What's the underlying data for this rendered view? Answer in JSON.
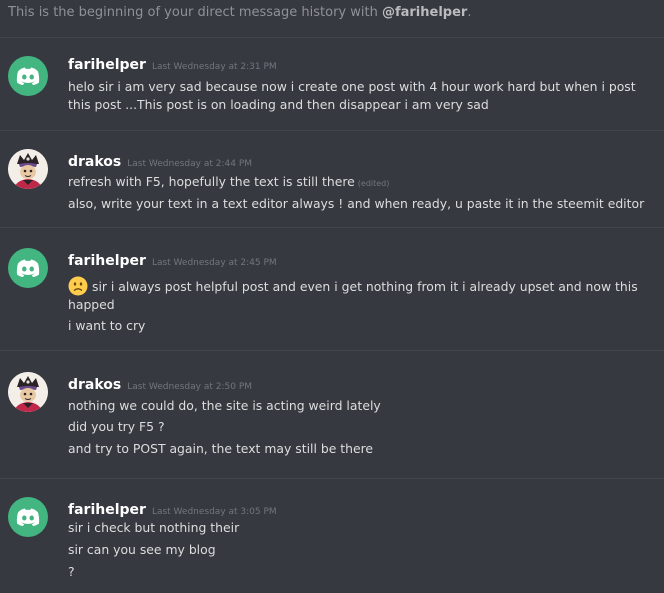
{
  "intro": {
    "prefix": "This is the beginning of your direct message history with ",
    "handle": "@farihelper",
    "suffix": "."
  },
  "colors": {
    "background": "#36393f",
    "discord_green": "#43b581",
    "username": "#ffffff",
    "timestamp": "#72767d",
    "message_text": "#dcddde"
  },
  "groups": [
    {
      "avatar": "discord-logo-icon",
      "username": "farihelper",
      "timestamp": "Last Wednesday at 2:31 PM",
      "messages": [
        "helo sir i am very sad because now i create one post with 4 hour work hard but when i post this post ...This post is on loading and then disappear  i am very sad"
      ]
    },
    {
      "avatar": "drakos-avatar",
      "username": "drakos",
      "timestamp": "Last Wednesday at 2:44 PM",
      "messages": [
        "refresh with F5, hopefully the text is still there",
        "also, write your text in a text editor always ! and when ready, u paste it in the steemit editor"
      ],
      "edited_label": "(edited)"
    },
    {
      "avatar": "discord-logo-icon",
      "username": "farihelper",
      "timestamp": "Last Wednesday at 2:45 PM",
      "messages": [
        "sir i always post helpful post and even i get nothing from it i already upset and now this happed",
        "i want to cry"
      ],
      "emoji": "frowning-face-emoji"
    },
    {
      "avatar": "drakos-avatar",
      "username": "drakos",
      "timestamp": "Last Wednesday at 2:50 PM",
      "messages": [
        "nothing we could do, the site is acting weird lately",
        "did you try F5 ?",
        "and try to POST again, the text may still be there"
      ]
    },
    {
      "avatar": "discord-logo-icon",
      "username": "farihelper",
      "timestamp": "Last Wednesday at 3:05 PM",
      "messages": [
        "sir i check but nothing their",
        "sir can you see my blog",
        "?"
      ]
    }
  ]
}
